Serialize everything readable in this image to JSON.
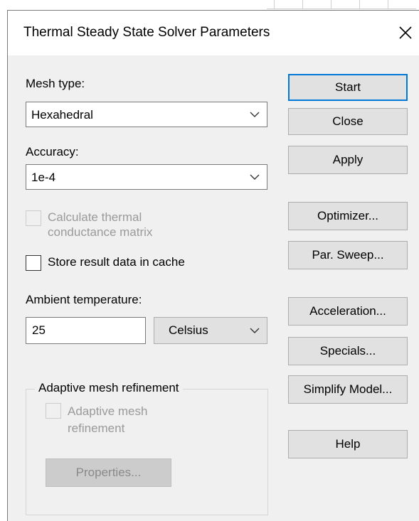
{
  "dialog": {
    "title": "Thermal Steady State Solver Parameters"
  },
  "mesh_type": {
    "label": "Mesh type:",
    "value": "Hexahedral"
  },
  "accuracy": {
    "label": "Accuracy:",
    "value": "1e-4"
  },
  "calc_thermal": {
    "line1": "Calculate thermal",
    "line2": "conductance matrix",
    "checked": false,
    "enabled": false
  },
  "store_cache": {
    "label": "Store result data in cache",
    "checked": false
  },
  "ambient": {
    "label": "Ambient temperature:",
    "value": "25",
    "unit": "Celsius"
  },
  "adaptive": {
    "group_title": "Adaptive mesh refinement",
    "checkbox_line1": "Adaptive mesh",
    "checkbox_line2": "refinement",
    "properties_label": "Properties..."
  },
  "buttons": {
    "start": "Start",
    "close": "Close",
    "apply": "Apply",
    "optimizer": "Optimizer...",
    "par_sweep": "Par. Sweep...",
    "acceleration": "Acceleration...",
    "specials": "Specials...",
    "simplify": "Simplify Model...",
    "help": "Help"
  },
  "colors": {
    "dialog_bg": "#f0f0f0",
    "default_button_border": "#0078d7",
    "disabled_text": "#9a9a9a"
  },
  "icons": {
    "close": "close-x-icon",
    "dropdown": "chevron-down-icon"
  }
}
